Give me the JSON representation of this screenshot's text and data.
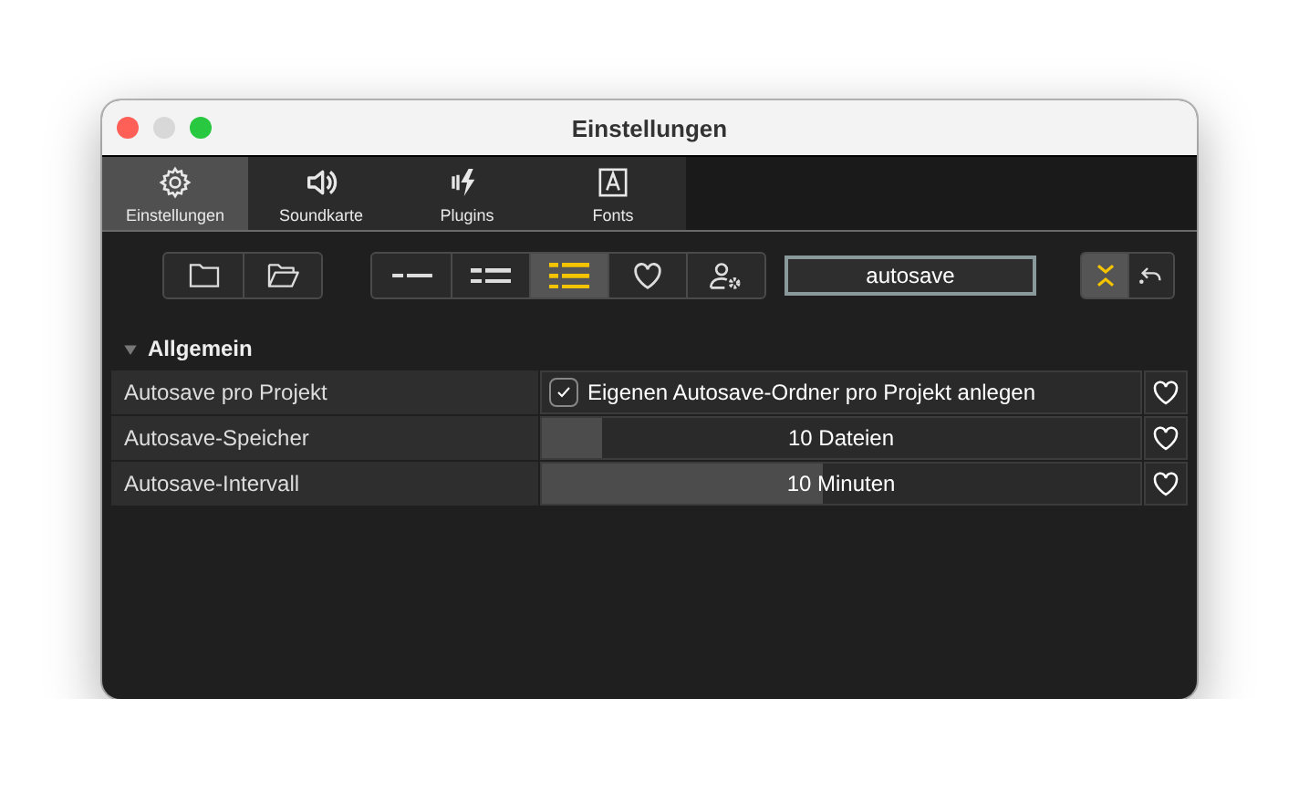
{
  "window": {
    "title": "Einstellungen"
  },
  "tabs": [
    {
      "label": "Einstellungen",
      "selected": true
    },
    {
      "label": "Soundkarte",
      "selected": false
    },
    {
      "label": "Plugins",
      "selected": false
    },
    {
      "label": "Fonts",
      "selected": false
    }
  ],
  "toolbar": {
    "view_buttons": [
      {
        "selected": false
      },
      {
        "selected": false
      },
      {
        "selected": true
      },
      {
        "selected": false
      },
      {
        "selected": false
      }
    ],
    "search": {
      "value": "autosave"
    },
    "tree_buttons": [
      {
        "selected": true
      },
      {
        "selected": false
      }
    ]
  },
  "section": {
    "title": "Allgemein",
    "expanded": true,
    "rows": [
      {
        "kind": "checkbox",
        "label": "Autosave pro Projekt",
        "text": "Eigenen Autosave-Ordner pro Projekt anlegen",
        "checked": true
      },
      {
        "kind": "slider",
        "label": "Autosave-Speicher",
        "text": "10 Dateien",
        "level": 0.1
      },
      {
        "kind": "slider",
        "label": "Autosave-Intervall",
        "text": "10 Minuten",
        "level": 0.47
      }
    ]
  }
}
